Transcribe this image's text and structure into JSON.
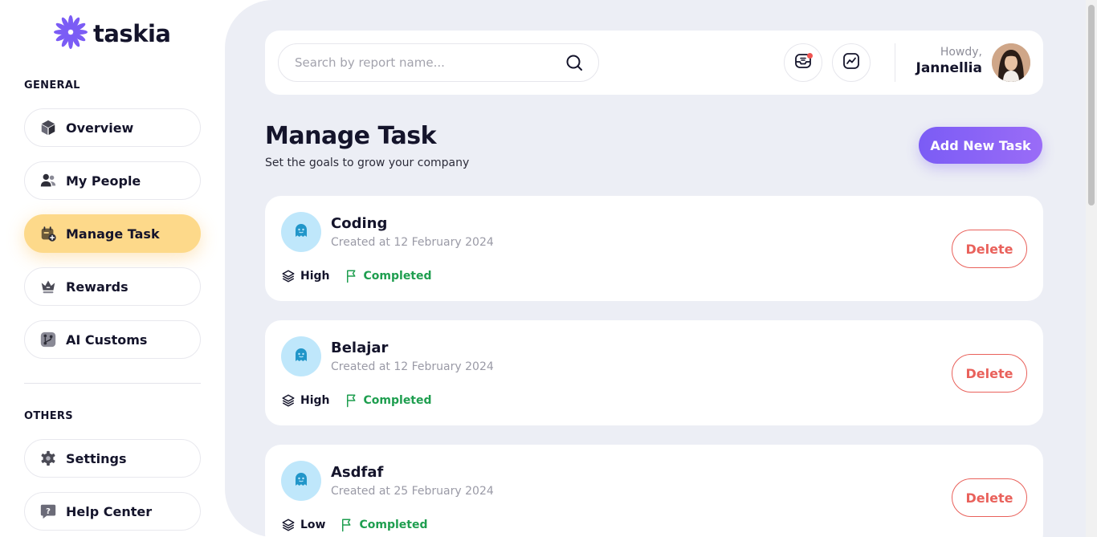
{
  "app": {
    "name": "taskia"
  },
  "sidebar": {
    "general_label": "GENERAL",
    "others_label": "OTHERS",
    "general_items": [
      {
        "label": "Overview",
        "icon": "cube-icon"
      },
      {
        "label": "My People",
        "icon": "people-icon"
      },
      {
        "label": "Manage Task",
        "icon": "calendar-add-icon",
        "active": true
      },
      {
        "label": "Rewards",
        "icon": "crown-icon"
      },
      {
        "label": "AI Customs",
        "icon": "git-branch-icon"
      }
    ],
    "other_items": [
      {
        "label": "Settings",
        "icon": "gear-icon"
      },
      {
        "label": "Help Center",
        "icon": "help-chat-icon"
      }
    ]
  },
  "header": {
    "search_placeholder": "Search by report name...",
    "greeting": "Howdy,",
    "user_name": "Jannellia"
  },
  "page": {
    "title": "Manage Task",
    "subtitle": "Set the goals to grow your company",
    "add_button": "Add New Task"
  },
  "tasks": [
    {
      "name": "Coding",
      "created": "Created at 12 February 2024",
      "priority": "High",
      "status": "Completed",
      "delete_label": "Delete"
    },
    {
      "name": "Belajar",
      "created": "Created at 12 February 2024",
      "priority": "High",
      "status": "Completed",
      "delete_label": "Delete"
    },
    {
      "name": "Asdfaf",
      "created": "Created at 25 February 2024",
      "priority": "Low",
      "status": "Completed",
      "delete_label": "Delete"
    }
  ],
  "colors": {
    "brand": "#7b5cf5",
    "active_nav": "#fdd98a",
    "status_green": "#1e9e4f",
    "danger": "#e9615b",
    "main_bg": "#eceef5"
  }
}
